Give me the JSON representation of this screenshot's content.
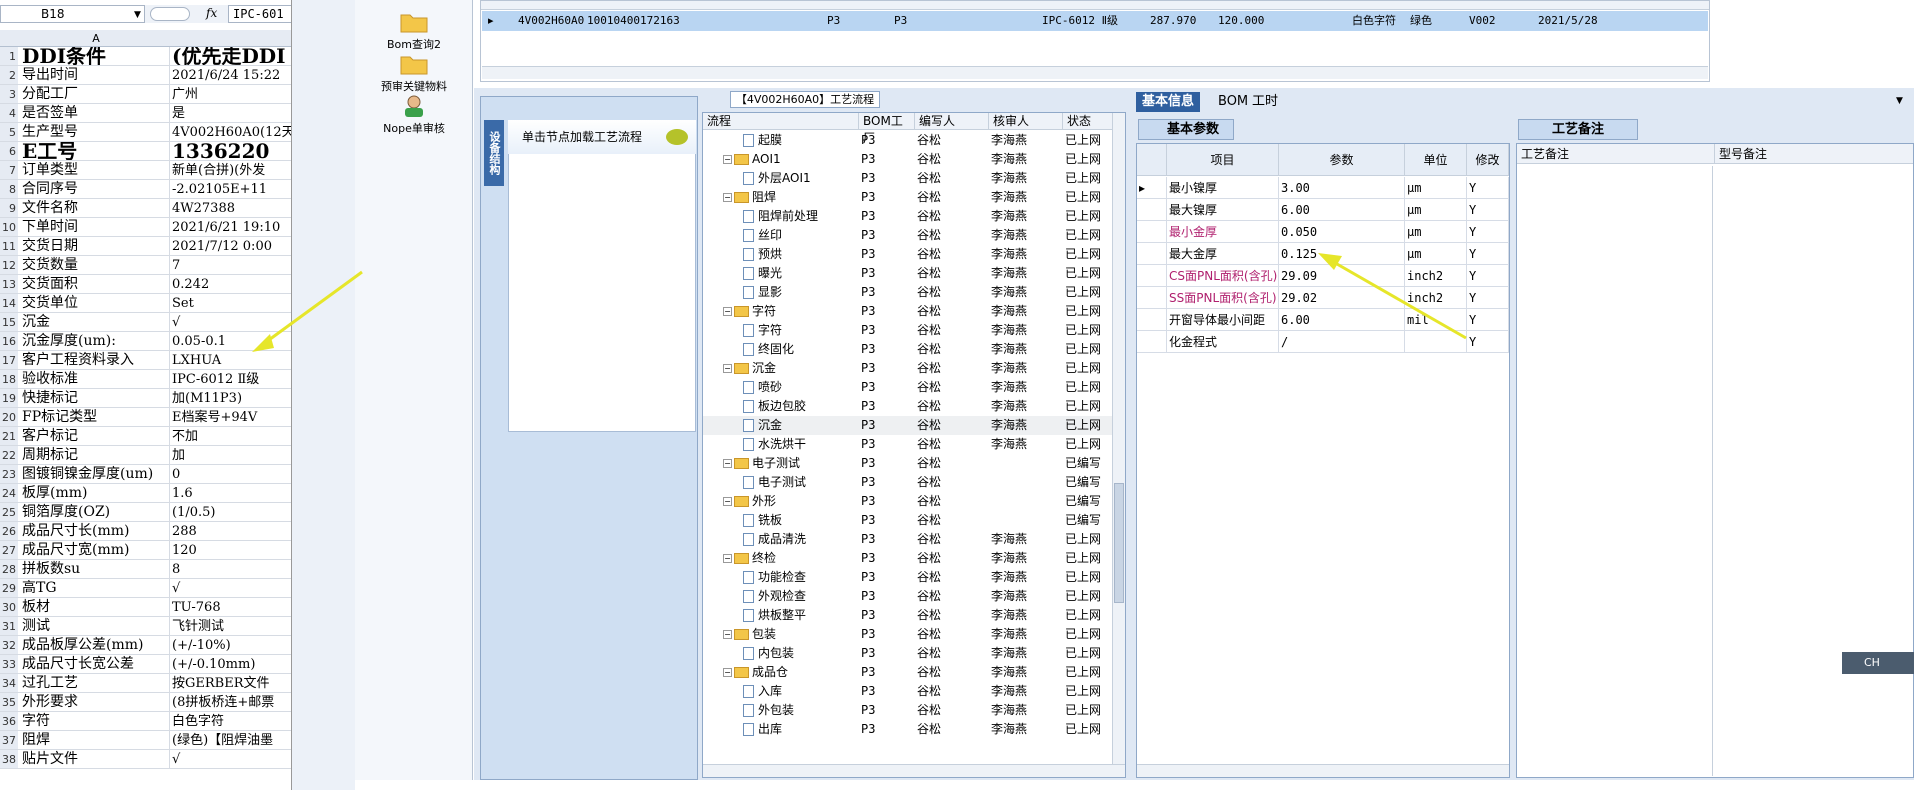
{
  "excel": {
    "namebox": "B18",
    "fx": "fx",
    "formula": "IPC-601",
    "col_a": "A",
    "rows": [
      {
        "n": "1",
        "a": "DDI条件",
        "b": "(优先走DDI",
        "big": true
      },
      {
        "n": "2",
        "a": "导出时间",
        "b": "2021/6/24 15:22"
      },
      {
        "n": "3",
        "a": "分配工厂",
        "b": "广州"
      },
      {
        "n": "4",
        "a": "是否签单",
        "b": "是"
      },
      {
        "n": "5",
        "a": "生产型号",
        "b": "4V002H60A0(12天"
      },
      {
        "n": "6",
        "a": "E工号",
        "b": "1336220",
        "big": true
      },
      {
        "n": "7",
        "a": "订单类型",
        "b": "新单(合拼)(外发"
      },
      {
        "n": "8",
        "a": "合同序号",
        "b": "-2.02105E+11"
      },
      {
        "n": "9",
        "a": "文件名称",
        "b": "4W27388"
      },
      {
        "n": "10",
        "a": "下单时间",
        "b": "2021/6/21 19:10"
      },
      {
        "n": "11",
        "a": "交货日期",
        "b": "2021/7/12 0:00"
      },
      {
        "n": "12",
        "a": "交货数量",
        "b": "7"
      },
      {
        "n": "13",
        "a": "交货面积",
        "b": "0.242"
      },
      {
        "n": "14",
        "a": "交货单位",
        "b": "Set"
      },
      {
        "n": "15",
        "a": "沉金",
        "b": "√"
      },
      {
        "n": "16",
        "a": "沉金厚度(um):",
        "b": "0.05-0.1"
      },
      {
        "n": "17",
        "a": "客户工程资料录入",
        "b": "LXHUA"
      },
      {
        "n": "18",
        "a": "验收标准",
        "b": "IPC-6012 Ⅱ级"
      },
      {
        "n": "19",
        "a": "快捷标记",
        "b": "加(M11P3)"
      },
      {
        "n": "20",
        "a": "FP标记类型",
        "b": "E档案号+94V"
      },
      {
        "n": "21",
        "a": "客户标记",
        "b": "不加"
      },
      {
        "n": "22",
        "a": "周期标记",
        "b": "加"
      },
      {
        "n": "23",
        "a": "图镀铜镍金厚度(um)",
        "b": "0"
      },
      {
        "n": "24",
        "a": "板厚(mm)",
        "b": "1.6"
      },
      {
        "n": "25",
        "a": "铜箔厚度(OZ)",
        "b": "(1/0.5)"
      },
      {
        "n": "26",
        "a": "成品尺寸长(mm)",
        "b": "288"
      },
      {
        "n": "27",
        "a": "成品尺寸宽(mm)",
        "b": "120"
      },
      {
        "n": "28",
        "a": "拼板数su",
        "b": "8"
      },
      {
        "n": "29",
        "a": "高TG",
        "b": "√"
      },
      {
        "n": "30",
        "a": "板材",
        "b": "TU-768"
      },
      {
        "n": "31",
        "a": "测试",
        "b": "飞针测试"
      },
      {
        "n": "32",
        "a": "成品板厚公差(mm)",
        "b": "(+/-10%)"
      },
      {
        "n": "33",
        "a": "成品尺寸长宽公差",
        "b": "(+/-0.10mm)"
      },
      {
        "n": "34",
        "a": "过孔工艺",
        "b": "按GERBER文件"
      },
      {
        "n": "35",
        "a": "外形要求",
        "b": "(8拼板桥连+邮票"
      },
      {
        "n": "36",
        "a": "字符",
        "b": "白色字符"
      },
      {
        "n": "37",
        "a": "阻焊",
        "b": "(绿色)【阻焊油墨"
      },
      {
        "n": "38",
        "a": "贴片文件",
        "b": "√"
      }
    ]
  },
  "toolbar": {
    "items": [
      {
        "label": "Bom查询2",
        "icon": "folder-icon"
      },
      {
        "label": "预审关键物料",
        "icon": "folder-icon"
      },
      {
        "label": "Nope单审核",
        "icon": "user-icon"
      }
    ]
  },
  "top_grid": {
    "row": [
      "4V002H60A0",
      "10010400172163",
      "P3",
      "P3",
      "IPC-6012 Ⅱ级",
      "287.970",
      "120.000",
      "白色字符",
      "绿色",
      "V002",
      "2021/5/28"
    ]
  },
  "left_panel": {
    "tab": "设备结构",
    "prompt": "单击节点加载工艺流程"
  },
  "flow": {
    "title": "【4V002H60A0】工艺流程",
    "headers": [
      "流程",
      "BOM工厂",
      "编写人",
      "核审人",
      "状态"
    ],
    "rows": [
      {
        "level": 2,
        "name": "起膜",
        "type": "doc",
        "factory": "P3",
        "writer": "谷松",
        "reviewer": "李海燕",
        "status": "已上网"
      },
      {
        "level": 1,
        "name": "AOI1",
        "type": "folder",
        "factory": "P3",
        "writer": "谷松",
        "reviewer": "李海燕",
        "status": "已上网"
      },
      {
        "level": 2,
        "name": "外层AOI1",
        "type": "doc",
        "factory": "P3",
        "writer": "谷松",
        "reviewer": "李海燕",
        "status": "已上网"
      },
      {
        "level": 1,
        "name": "阻焊",
        "type": "folder",
        "factory": "P3",
        "writer": "谷松",
        "reviewer": "李海燕",
        "status": "已上网"
      },
      {
        "level": 2,
        "name": "阻焊前处理",
        "type": "doc",
        "factory": "P3",
        "writer": "谷松",
        "reviewer": "李海燕",
        "status": "已上网"
      },
      {
        "level": 2,
        "name": "丝印",
        "type": "doc",
        "factory": "P3",
        "writer": "谷松",
        "reviewer": "李海燕",
        "status": "已上网"
      },
      {
        "level": 2,
        "name": "预烘",
        "type": "doc",
        "factory": "P3",
        "writer": "谷松",
        "reviewer": "李海燕",
        "status": "已上网"
      },
      {
        "level": 2,
        "name": "曝光",
        "type": "doc",
        "factory": "P3",
        "writer": "谷松",
        "reviewer": "李海燕",
        "status": "已上网"
      },
      {
        "level": 2,
        "name": "显影",
        "type": "doc",
        "factory": "P3",
        "writer": "谷松",
        "reviewer": "李海燕",
        "status": "已上网"
      },
      {
        "level": 1,
        "name": "字符",
        "type": "folder",
        "factory": "P3",
        "writer": "谷松",
        "reviewer": "李海燕",
        "status": "已上网"
      },
      {
        "level": 2,
        "name": "字符",
        "type": "doc",
        "factory": "P3",
        "writer": "谷松",
        "reviewer": "李海燕",
        "status": "已上网"
      },
      {
        "level": 2,
        "name": "终固化",
        "type": "doc",
        "factory": "P3",
        "writer": "谷松",
        "reviewer": "李海燕",
        "status": "已上网"
      },
      {
        "level": 1,
        "name": "沉金",
        "type": "folder",
        "factory": "P3",
        "writer": "谷松",
        "reviewer": "李海燕",
        "status": "已上网"
      },
      {
        "level": 2,
        "name": "喷砂",
        "type": "doc",
        "factory": "P3",
        "writer": "谷松",
        "reviewer": "李海燕",
        "status": "已上网"
      },
      {
        "level": 2,
        "name": "板边包胶",
        "type": "doc",
        "factory": "P3",
        "writer": "谷松",
        "reviewer": "李海燕",
        "status": "已上网"
      },
      {
        "level": 2,
        "name": "沉金",
        "type": "doc",
        "factory": "P3",
        "writer": "谷松",
        "reviewer": "李海燕",
        "status": "已上网",
        "selected": true
      },
      {
        "level": 2,
        "name": "水洗烘干",
        "type": "doc",
        "factory": "P3",
        "writer": "谷松",
        "reviewer": "李海燕",
        "status": "已上网"
      },
      {
        "level": 1,
        "name": "电子测试",
        "type": "folder",
        "factory": "P3",
        "writer": "谷松",
        "reviewer": "",
        "status": "已编写"
      },
      {
        "level": 2,
        "name": "电子测试",
        "type": "doc",
        "factory": "P3",
        "writer": "谷松",
        "reviewer": "",
        "status": "已编写"
      },
      {
        "level": 1,
        "name": "外形",
        "type": "folder",
        "factory": "P3",
        "writer": "谷松",
        "reviewer": "",
        "status": "已编写"
      },
      {
        "level": 2,
        "name": "铣板",
        "type": "doc",
        "factory": "P3",
        "writer": "谷松",
        "reviewer": "",
        "status": "已编写"
      },
      {
        "level": 2,
        "name": "成品清洗",
        "type": "doc",
        "factory": "P3",
        "writer": "谷松",
        "reviewer": "李海燕",
        "status": "已上网"
      },
      {
        "level": 1,
        "name": "终检",
        "type": "folder",
        "factory": "P3",
        "writer": "谷松",
        "reviewer": "李海燕",
        "status": "已上网"
      },
      {
        "level": 2,
        "name": "功能检查",
        "type": "doc",
        "factory": "P3",
        "writer": "谷松",
        "reviewer": "李海燕",
        "status": "已上网"
      },
      {
        "level": 2,
        "name": "外观检查",
        "type": "doc",
        "factory": "P3",
        "writer": "谷松",
        "reviewer": "李海燕",
        "status": "已上网"
      },
      {
        "level": 2,
        "name": "烘板整平",
        "type": "doc",
        "factory": "P3",
        "writer": "谷松",
        "reviewer": "李海燕",
        "status": "已上网"
      },
      {
        "level": 1,
        "name": "包装",
        "type": "folder",
        "factory": "P3",
        "writer": "谷松",
        "reviewer": "李海燕",
        "status": "已上网"
      },
      {
        "level": 2,
        "name": "内包装",
        "type": "doc",
        "factory": "P3",
        "writer": "谷松",
        "reviewer": "李海燕",
        "status": "已上网"
      },
      {
        "level": 1,
        "name": "成品仓",
        "type": "folder",
        "factory": "P3",
        "writer": "谷松",
        "reviewer": "李海燕",
        "status": "已上网"
      },
      {
        "level": 2,
        "name": "入库",
        "type": "doc",
        "factory": "P3",
        "writer": "谷松",
        "reviewer": "李海燕",
        "status": "已上网"
      },
      {
        "level": 2,
        "name": "外包装",
        "type": "doc",
        "factory": "P3",
        "writer": "谷松",
        "reviewer": "李海燕",
        "status": "已上网"
      },
      {
        "level": 2,
        "name": "出库",
        "type": "doc",
        "factory": "P3",
        "writer": "谷松",
        "reviewer": "李海燕",
        "status": "已上网"
      }
    ]
  },
  "info_tabs": [
    "基本信息",
    "BOM",
    "工时"
  ],
  "basic_params": {
    "header": "基本参数",
    "columns": [
      "项目",
      "参数",
      "单位",
      "修改"
    ],
    "rows": [
      {
        "item": "最小镍厚",
        "value": "3.00",
        "unit": "μm",
        "edit": "Y",
        "pink": false
      },
      {
        "item": "最大镍厚",
        "value": "6.00",
        "unit": "μm",
        "edit": "Y",
        "pink": false
      },
      {
        "item": "最小金厚",
        "value": "0.050",
        "unit": "μm",
        "edit": "Y",
        "pink": true
      },
      {
        "item": "最大金厚",
        "value": "0.125",
        "unit": "μm",
        "edit": "Y",
        "pink": false
      },
      {
        "item": "CS面PNL面积(含孔)",
        "value": "29.09",
        "unit": "inch2",
        "edit": "Y",
        "pink": true
      },
      {
        "item": "SS面PNL面积(含孔)",
        "value": "29.02",
        "unit": "inch2",
        "edit": "Y",
        "pink": true
      },
      {
        "item": "开窗导体最小间距",
        "value": "6.00",
        "unit": "mil",
        "edit": "Y",
        "pink": false
      },
      {
        "item": "化金程式",
        "value": "/",
        "unit": "",
        "edit": "Y",
        "pink": false
      }
    ]
  },
  "notes": {
    "header": "工艺备注",
    "col1": "工艺备注",
    "col2": "型号备注"
  },
  "ime": {
    "label": "CH"
  },
  "colors": {
    "arrow": "#e6e62a",
    "selected_row": "#b9d5f2",
    "tab_active": "#2f5f9f"
  }
}
